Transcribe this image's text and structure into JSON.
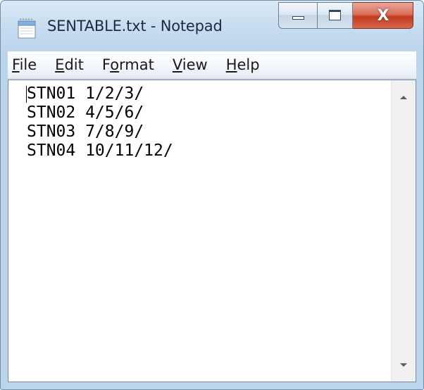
{
  "window": {
    "title": "SENTABLE.txt - Notepad",
    "app_icon": "notepad-icon",
    "colors": {
      "frame": "#c6dcf0",
      "close_button": "#c4391f",
      "text": "#000000"
    }
  },
  "caption_buttons": {
    "minimize": "minimize-icon",
    "maximize": "maximize-icon",
    "close_glyph": "X"
  },
  "menu": {
    "items": [
      {
        "pre": "",
        "key": "F",
        "post": "ile"
      },
      {
        "pre": "",
        "key": "E",
        "post": "dit"
      },
      {
        "pre": "F",
        "key": "o",
        "post": "rmat"
      },
      {
        "pre": "",
        "key": "V",
        "post": "iew"
      },
      {
        "pre": "",
        "key": "H",
        "post": "elp"
      }
    ]
  },
  "editor": {
    "lines": [
      "STN01 1/2/3/",
      "STN02 4/5/6/",
      "STN03 7/8/9/",
      "STN04 10/11/12/"
    ]
  }
}
